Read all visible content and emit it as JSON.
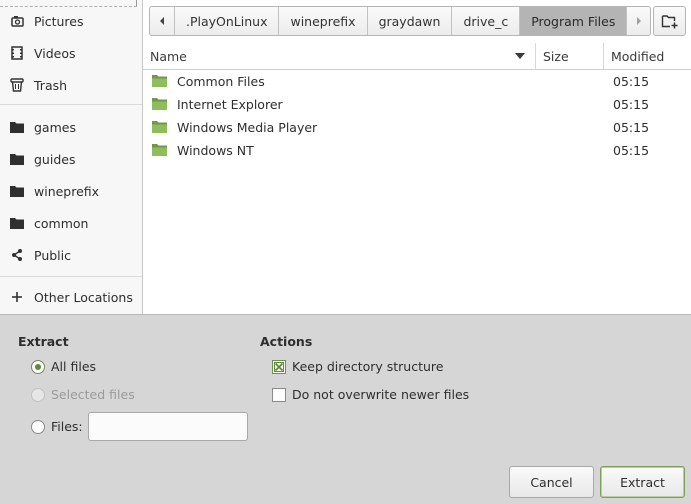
{
  "sidebar": {
    "items": [
      {
        "label": "Pictures",
        "icon": "camera-icon"
      },
      {
        "label": "Videos",
        "icon": "film-icon"
      },
      {
        "label": "Trash",
        "icon": "trash-icon"
      },
      {
        "label": "games",
        "icon": "folder-icon"
      },
      {
        "label": "guides",
        "icon": "folder-icon"
      },
      {
        "label": "wineprefix",
        "icon": "folder-icon"
      },
      {
        "label": "common",
        "icon": "folder-icon"
      },
      {
        "label": "Public",
        "icon": "share-icon"
      },
      {
        "label": "Other Locations",
        "icon": "plus-icon"
      }
    ]
  },
  "pathbar": {
    "segments": [
      ".PlayOnLinux",
      "wineprefix",
      "graydawn",
      "drive_c",
      "Program Files"
    ],
    "active_index": 4
  },
  "file_list": {
    "columns": {
      "name": "Name",
      "size": "Size",
      "modified": "Modified"
    },
    "rows": [
      {
        "name": "Common Files",
        "size": "",
        "modified": "05:15"
      },
      {
        "name": "Internet Explorer",
        "size": "",
        "modified": "05:15"
      },
      {
        "name": "Windows Media Player",
        "size": "",
        "modified": "05:15"
      },
      {
        "name": "Windows NT",
        "size": "",
        "modified": "05:15"
      }
    ]
  },
  "extract": {
    "title": "Extract",
    "all_files": "All files",
    "selected_files": "Selected files",
    "files": "Files:",
    "files_value": "",
    "selected": "all_files"
  },
  "actions": {
    "title": "Actions",
    "keep_structure": "Keep directory structure",
    "keep_structure_checked": true,
    "no_overwrite": "Do not overwrite newer files",
    "no_overwrite_checked": false
  },
  "buttons": {
    "cancel": "Cancel",
    "extract": "Extract"
  },
  "colors": {
    "accent": "#5f8a3a",
    "folder": "#7fae4f",
    "active_segment": "#b4b4b4"
  }
}
